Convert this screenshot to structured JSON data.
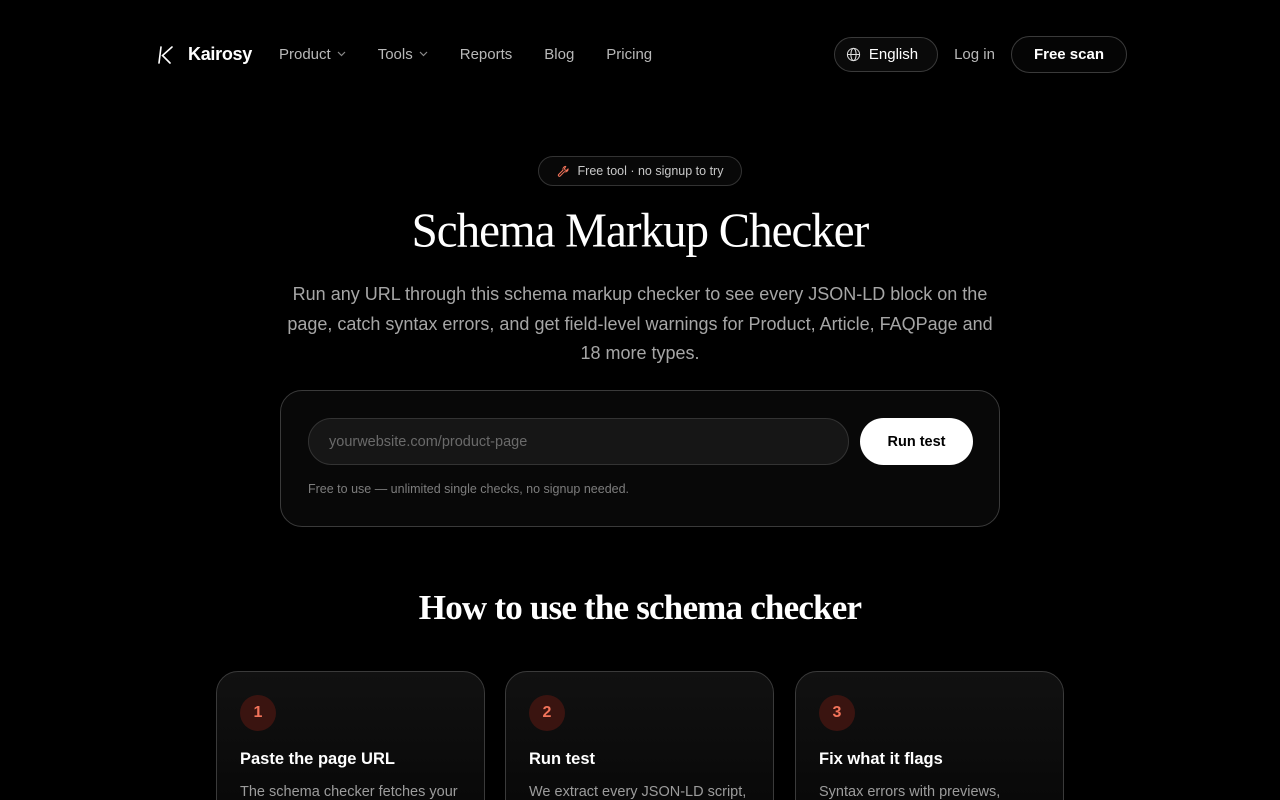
{
  "brand": {
    "name": "Kairosy"
  },
  "nav": {
    "links": [
      {
        "label": "Product",
        "has_dropdown": true
      },
      {
        "label": "Tools",
        "has_dropdown": true
      },
      {
        "label": "Reports",
        "has_dropdown": false
      },
      {
        "label": "Blog",
        "has_dropdown": false
      },
      {
        "label": "Pricing",
        "has_dropdown": false
      }
    ],
    "language": "English",
    "login": "Log in",
    "cta": "Free scan"
  },
  "hero": {
    "badge": "Free tool · no signup to try",
    "title": "Schema Markup Checker",
    "subtitle": "Run any URL through this schema markup checker to see every JSON-LD block on the page, catch syntax errors, and get field-level warnings for Product, Article, FAQPage and 18 more types."
  },
  "tool": {
    "input_placeholder": "yourwebsite.com/product-page",
    "input_value": "",
    "run_label": "Run test",
    "note": "Free to use — unlimited single checks, no signup needed."
  },
  "how_to": {
    "title": "How to use the schema checker",
    "steps": [
      {
        "number": "1",
        "title": "Paste the page URL",
        "desc": "The schema checker fetches your"
      },
      {
        "number": "2",
        "title": "Run test",
        "desc": "We extract every JSON-LD script,"
      },
      {
        "number": "3",
        "title": "Fix what it flags",
        "desc": "Syntax errors with previews,"
      }
    ]
  },
  "colors": {
    "background": "#000000",
    "accent": "#f2735a",
    "accent_bg": "#3a1410",
    "muted_text": "#a6a6a6"
  },
  "icons": {
    "logo": "k-logo-icon",
    "globe": "globe-icon",
    "chevron": "chevron-down-icon",
    "badge": "wrench-icon"
  }
}
